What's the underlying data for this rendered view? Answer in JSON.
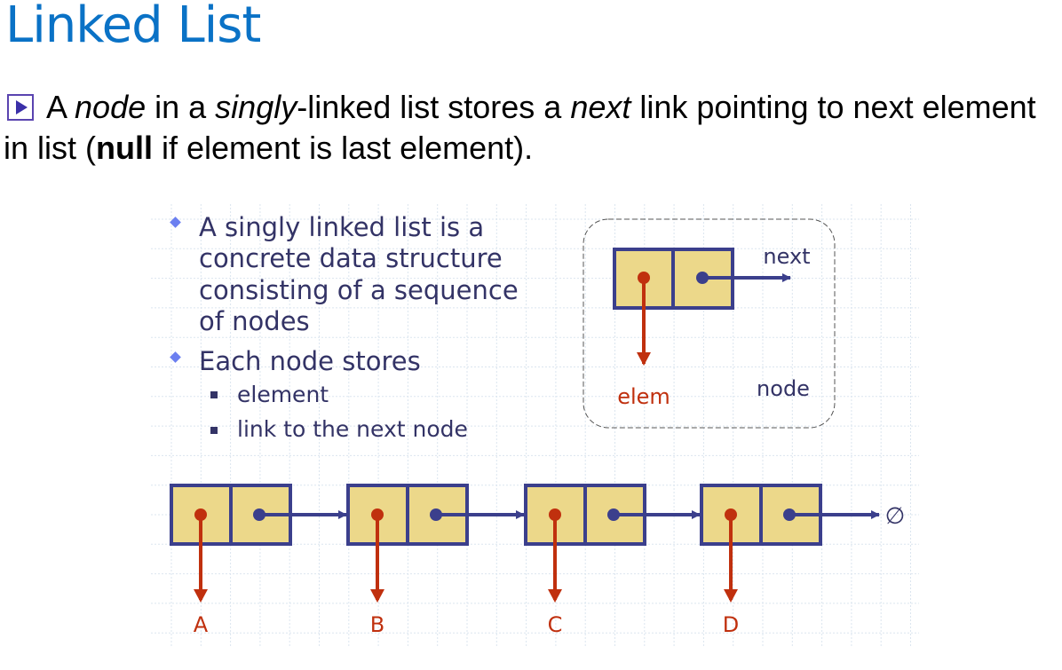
{
  "title": "Linked List",
  "intro": {
    "icon": "play-bullet-icon",
    "parts": [
      "A ",
      "node",
      " in a ",
      "singly",
      "-linked list stores a ",
      "next",
      " link pointing to next element in list (",
      "null",
      " if element is last element)."
    ]
  },
  "diagram": {
    "bullets": [
      {
        "lines": [
          "A singly linked list is a",
          "concrete data structure",
          "consisting of a sequence",
          "of nodes"
        ]
      },
      {
        "lines": [
          "Each node stores"
        ],
        "sub": [
          "element",
          "link to the next node"
        ]
      }
    ],
    "inset": {
      "next_label": "next",
      "elem_label": "elem",
      "node_label": "node"
    },
    "nodes": [
      "A",
      "B",
      "C",
      "D"
    ],
    "null_symbol": "∅",
    "colors": {
      "node_fill": "#ecd88a",
      "node_border": "#3b3f8c",
      "elem_arrow": "#c0300e",
      "link": "#3b3f8c",
      "grid": "#d6e2ee"
    }
  }
}
